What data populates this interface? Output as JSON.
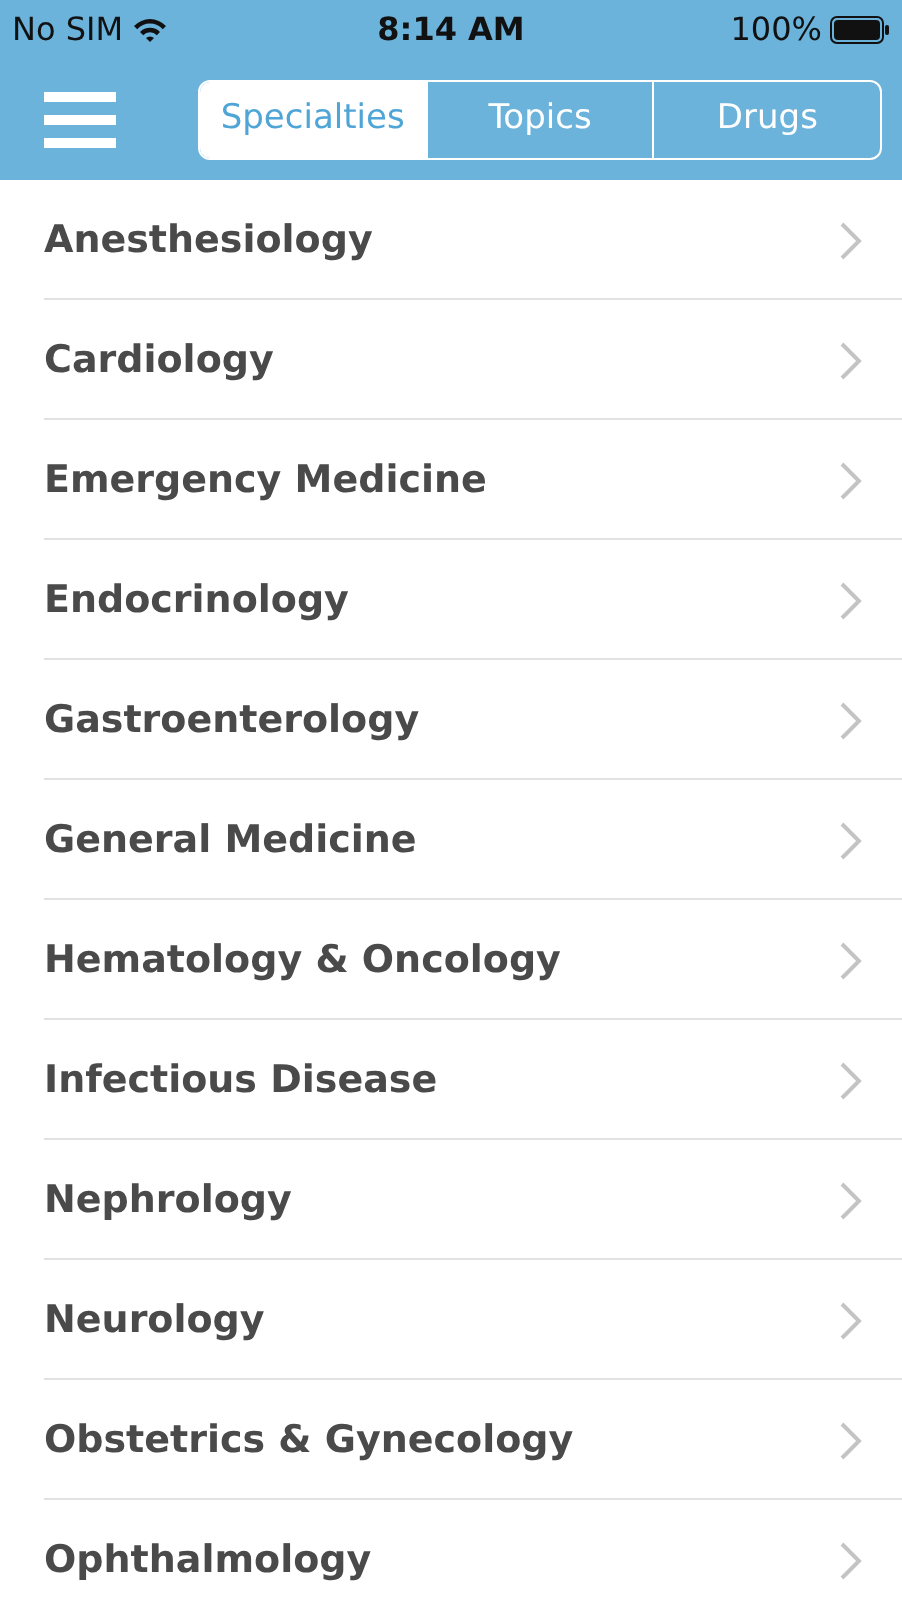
{
  "status_bar": {
    "carrier": "No SIM",
    "time": "8:14 AM",
    "battery": "100%"
  },
  "tabs": [
    {
      "label": "Specialties",
      "selected": true
    },
    {
      "label": "Topics",
      "selected": false
    },
    {
      "label": "Drugs",
      "selected": false
    }
  ],
  "items": [
    "Anesthesiology",
    "Cardiology",
    "Emergency Medicine",
    "Endocrinology",
    "Gastroenterology",
    "General Medicine",
    "Hematology & Oncology",
    "Infectious Disease",
    "Nephrology",
    "Neurology",
    "Obstetrics & Gynecology",
    "Ophthalmology"
  ]
}
